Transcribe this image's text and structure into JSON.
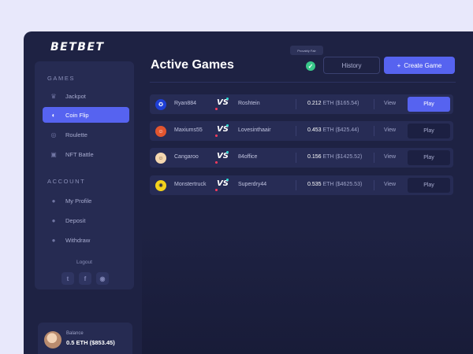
{
  "brand": {
    "logo_text": "BETBET"
  },
  "sidebar": {
    "games_title": "GAMES",
    "games": [
      {
        "label": "Jackpot",
        "icon": "crown-icon",
        "active": false
      },
      {
        "label": "Coin Flip",
        "icon": "coin-icon",
        "active": true
      },
      {
        "label": "Roulette",
        "icon": "roulette-icon",
        "active": false
      },
      {
        "label": "NFT Battle",
        "icon": "nft-icon",
        "active": false
      }
    ],
    "account_title": "ACCOUNT",
    "account": [
      {
        "label": "My Profile",
        "icon": "user-icon"
      },
      {
        "label": "Deposit",
        "icon": "user-icon"
      },
      {
        "label": "Withdraw",
        "icon": "user-icon"
      }
    ],
    "logout_label": "Logout",
    "socials": [
      "twitter-icon",
      "facebook-icon",
      "discord-icon"
    ],
    "balance": {
      "label": "Balance",
      "value": "0.5 ETH ($853.45)"
    }
  },
  "header": {
    "title": "Active Games",
    "tooltip": "Provably Fair",
    "history_label": "History",
    "create_label": "Create Game",
    "create_icon": "+"
  },
  "colors": {
    "accent": "#5663f0",
    "background": "#1e2243",
    "panel": "#262b52",
    "verified": "#39c88a"
  },
  "games": [
    {
      "player1": "Ryan884",
      "player2": "Roshtein",
      "amount": "0.212",
      "unit": "ETH",
      "usd": "($165.54)",
      "view": "View",
      "play": "Play",
      "play_primary": true
    },
    {
      "player1": "Maxiums55",
      "player2": "Lovesinthaair",
      "amount": "0.453",
      "unit": "ETH",
      "usd": "($425.44)",
      "view": "View",
      "play": "Play",
      "play_primary": false
    },
    {
      "player1": "Cangaroo",
      "player2": "84office",
      "amount": "0.156",
      "unit": "ETH",
      "usd": "($1425.52)",
      "view": "View",
      "play": "Play",
      "play_primary": false
    },
    {
      "player1": "Monstertruck",
      "player2": "Superdry44",
      "amount": "0.535",
      "unit": "ETH",
      "usd": "($4625.53)",
      "view": "View",
      "play": "Play",
      "play_primary": false
    }
  ]
}
